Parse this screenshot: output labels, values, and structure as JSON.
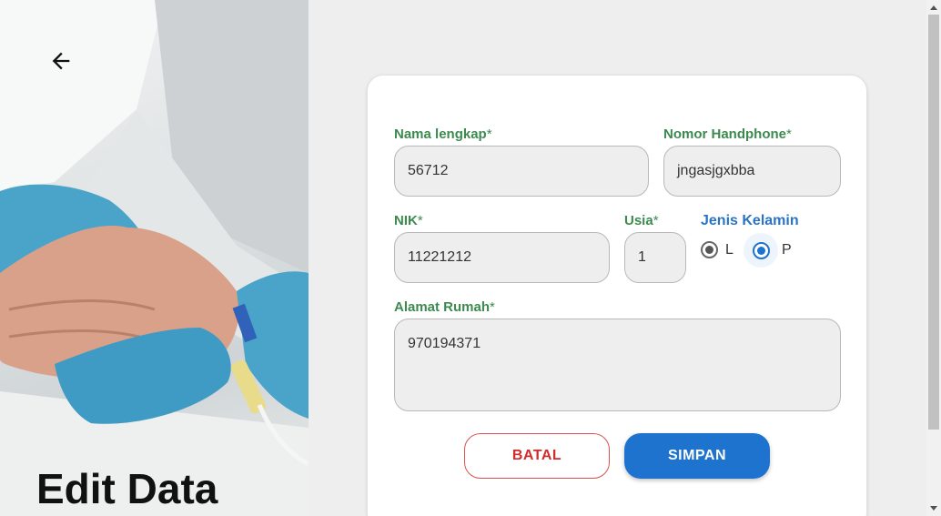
{
  "hero": {
    "title": "Edit Data",
    "back_icon": "arrow-left-icon"
  },
  "form": {
    "nama": {
      "label": "Nama lengkap",
      "required": "*",
      "value": "56712"
    },
    "phone": {
      "label": "Nomor Handphone",
      "required": "*",
      "value": "jngasjgxbba"
    },
    "nik": {
      "label": "NIK",
      "required": "*",
      "value": "11221212"
    },
    "usia": {
      "label": "Usia",
      "required": "*",
      "value": "1"
    },
    "gender": {
      "label": "Jenis Kelamin",
      "options": [
        {
          "label": "L",
          "selected": false
        },
        {
          "label": "P",
          "selected": true
        }
      ]
    },
    "alamat": {
      "label": "Alamat Rumah",
      "required": "*",
      "value": "970194371"
    }
  },
  "actions": {
    "cancel_label": "BATAL",
    "save_label": "SIMPAN"
  },
  "colors": {
    "label_green": "#3d8a4f",
    "accent_blue": "#1e73cf",
    "cancel_red": "#cf2c2c"
  }
}
